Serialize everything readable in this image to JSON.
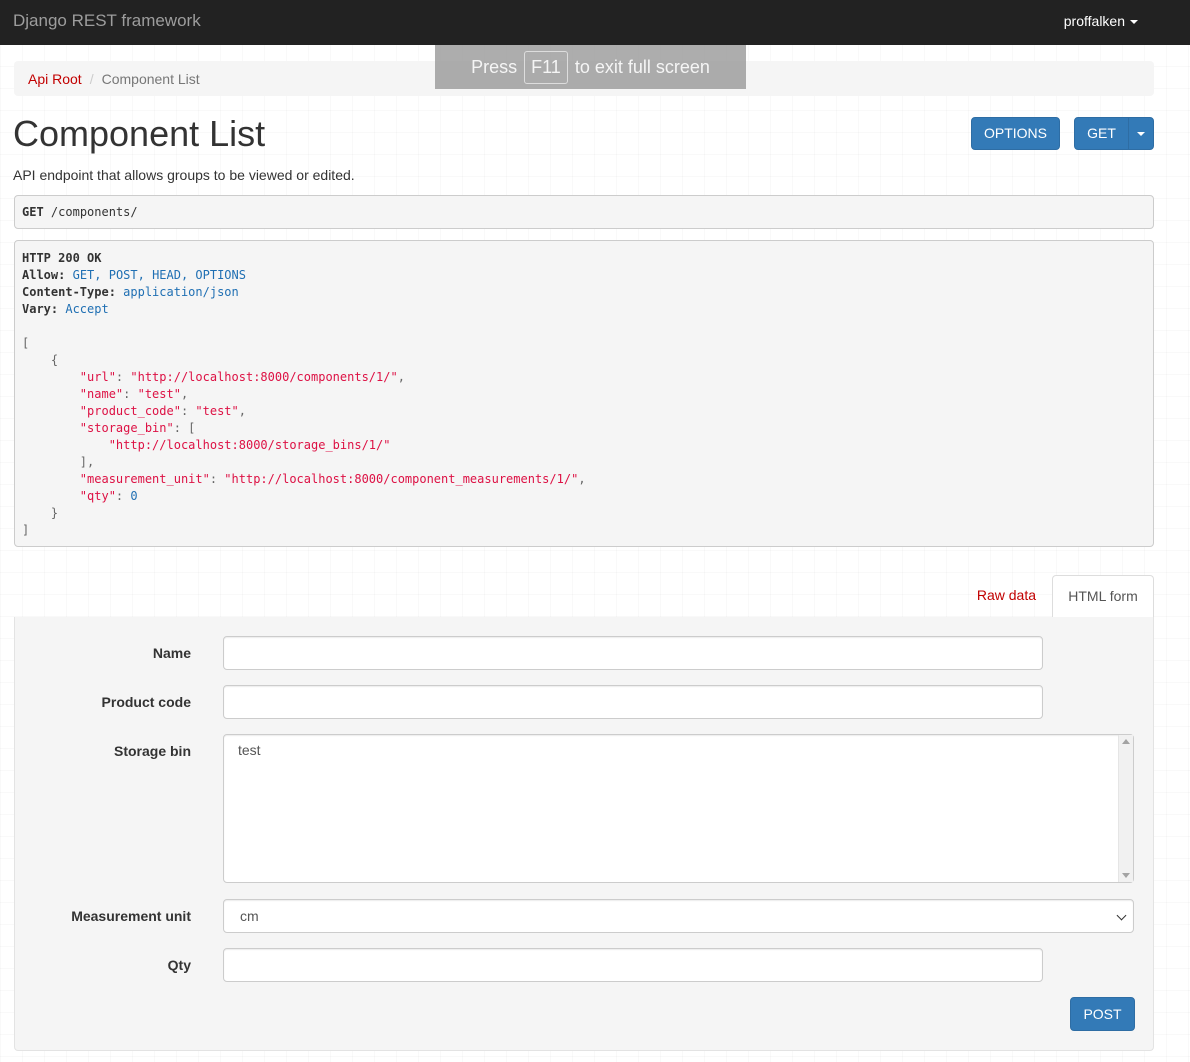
{
  "navbar": {
    "brand": "Django REST framework",
    "user": "proffalken"
  },
  "fullscreen_toast": {
    "press": "Press",
    "key": "F11",
    "rest": "to exit full screen"
  },
  "breadcrumb": {
    "root": "Api Root",
    "sep": "/",
    "current": "Component List"
  },
  "page": {
    "title": "Component List",
    "description": "API endpoint that allows groups to be viewed or edited.",
    "options_label": "OPTIONS",
    "get_label": "GET"
  },
  "request": {
    "method": "GET",
    "path": "/components/"
  },
  "response": {
    "status": "HTTP 200 OK",
    "headers": [
      {
        "name": "Allow:",
        "value": "GET, POST, HEAD, OPTIONS"
      },
      {
        "name": "Content-Type:",
        "value": "application/json"
      },
      {
        "name": "Vary:",
        "value": "Accept"
      }
    ],
    "body": {
      "url_key": "\"url\"",
      "url_val": "\"http://localhost:8000/components/1/\"",
      "name_key": "\"name\"",
      "name_val": "\"test\"",
      "product_code_key": "\"product_code\"",
      "product_code_val": "\"test\"",
      "storage_bin_key": "\"storage_bin\"",
      "storage_bin_val": "\"http://localhost:8000/storage_bins/1/\"",
      "measurement_unit_key": "\"measurement_unit\"",
      "measurement_unit_val": "\"http://localhost:8000/component_measurements/1/\"",
      "qty_key": "\"qty\"",
      "qty_val": "0"
    }
  },
  "tabs": {
    "raw": "Raw data",
    "html": "HTML form"
  },
  "form": {
    "name_label": "Name",
    "name_value": "",
    "product_code_label": "Product code",
    "product_code_value": "",
    "storage_bin_label": "Storage bin",
    "storage_bin_option": "test",
    "measurement_unit_label": "Measurement unit",
    "measurement_unit_value": "cm",
    "qty_label": "Qty",
    "qty_value": "",
    "post_label": "POST"
  }
}
